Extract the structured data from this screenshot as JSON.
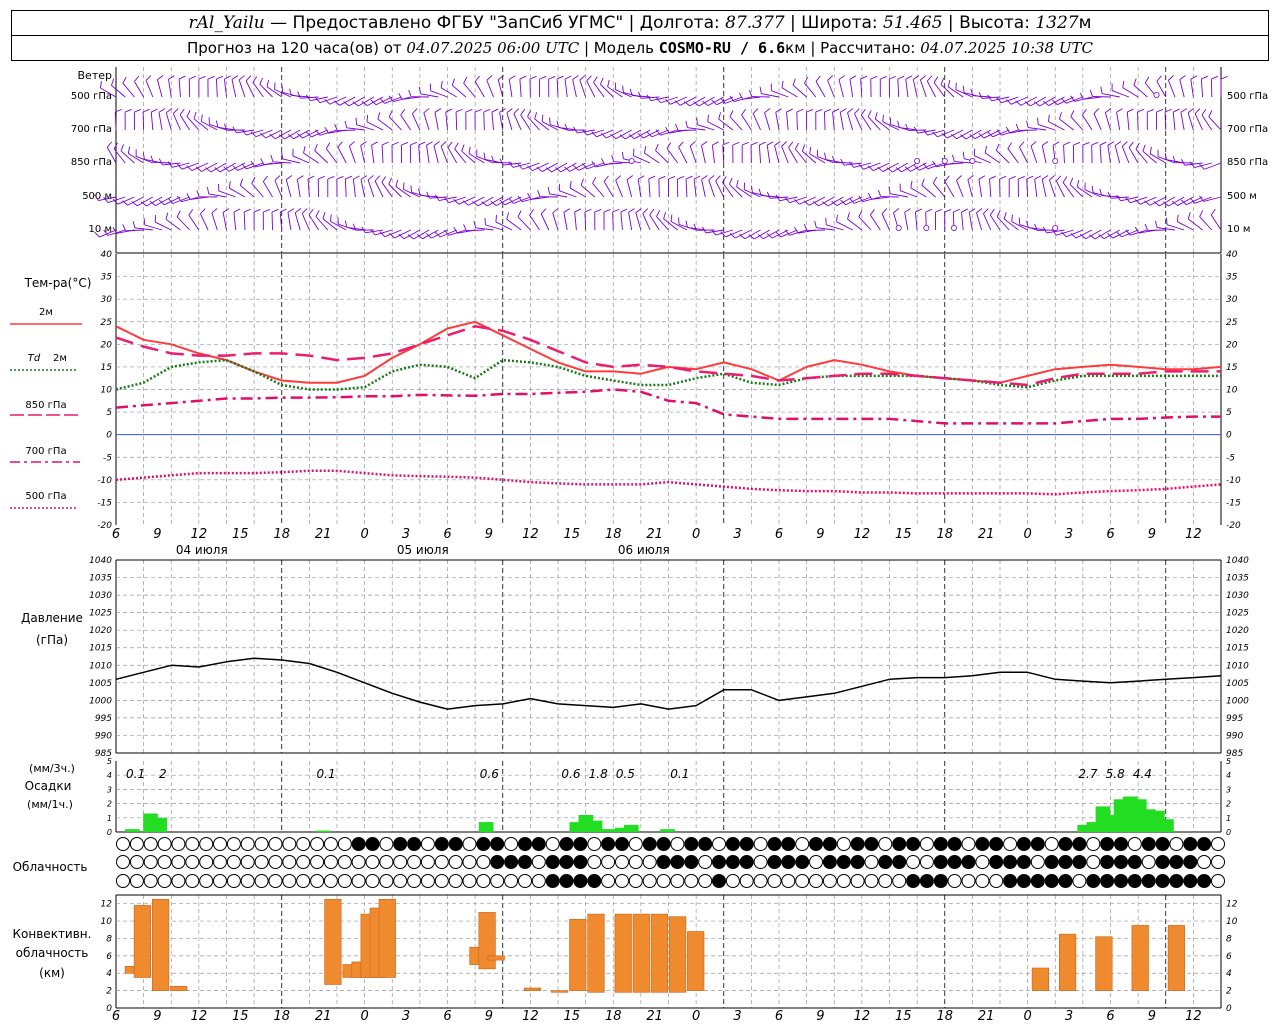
{
  "header": {
    "station": "rAl_Yailu",
    "dash": " — ",
    "provider": "Предоставлено ФГБУ \"ЗапСиб УГМС\"",
    "sep": " | ",
    "lon_label": "Долгота: ",
    "lon_value": "87.377",
    "lat_label": "Широта: ",
    "lat_value": "51.465",
    "alt_label": "Высота: ",
    "alt_value": "1327",
    "alt_unit": "м",
    "forecast_prefix": "Прогноз на 120 часа(ов) от ",
    "forecast_start": "04.07.2025 06:00 UTC",
    "model_label": "Модель ",
    "model_name": "COSMO-RU / 6.6",
    "model_unit": "км",
    "computed_label": "Рассчитано: ",
    "computed_value": "04.07.2025 10:38 UTC"
  },
  "colors": {
    "t2m": "#ff3b3b",
    "td2m": "#1a7a1a",
    "t850": "#ee1c6e",
    "t700": "#e0106a",
    "t500": "#e0106a",
    "wind": "#7a00d6",
    "zero_line": "#3355ff",
    "precip": "#22dd22",
    "convective": "#ef8a2f",
    "pressure": "#000000",
    "grid": "#999999"
  },
  "labels": {
    "wind_title": "Ветер",
    "wind_levels": [
      "500 гПа",
      "700 гПа",
      "850 гПа",
      "500 м",
      "10 м"
    ],
    "temp_title": "Тем-ра(°С)",
    "t2m_label": "2м",
    "td_label": "Td",
    "td_level": "2м",
    "t850_label": "850 гПа",
    "t700_label": "700 гПа",
    "t500_label": "500 гПа",
    "pressure_title": "Давление",
    "pressure_unit": "(гПа)",
    "precip_unit3": "(мм/3ч.)",
    "precip_title": "Осадки",
    "precip_unit1": "(мм/1ч.)",
    "cloud_title": "Облачность",
    "conv_title1": "Конвективн.",
    "conv_title2": "облачность",
    "conv_unit": "(км)"
  },
  "chart_data": [
    {
      "panel": "wind",
      "type": "wind_barbs",
      "levels": [
        "500 гПа",
        "700 гПа",
        "850 гПа",
        "500 м",
        "10 м"
      ],
      "x_hours": [
        0,
        120
      ]
    },
    {
      "panel": "temperature",
      "type": "line",
      "ylim": [
        -20,
        40
      ],
      "yticks": [
        -20,
        -15,
        -10,
        -5,
        0,
        5,
        10,
        15,
        20,
        25,
        30,
        35,
        40
      ],
      "x_tick_labels": [
        "6",
        "9",
        "12",
        "15",
        "18",
        "21",
        "0",
        "3",
        "6",
        "9",
        "12",
        "15",
        "18",
        "21",
        "0",
        "3",
        "6",
        "9",
        "12",
        "15",
        "18",
        "21",
        "0",
        "3",
        "6",
        "9",
        "12"
      ],
      "day_labels": [
        "04 июля",
        "05 июля",
        "06 июля"
      ],
      "x_hours": [
        0,
        3,
        6,
        9,
        12,
        15,
        18,
        21,
        24,
        27,
        30,
        33,
        36,
        39,
        42,
        45,
        48,
        51,
        54,
        57,
        60,
        63,
        66,
        69,
        72,
        75,
        78,
        81,
        84,
        87,
        90,
        93,
        96,
        99,
        102,
        105,
        108,
        111,
        114,
        117,
        120
      ],
      "series": [
        {
          "name": "2м",
          "style": "solid",
          "values": [
            24,
            21,
            20,
            18,
            16.5,
            14,
            12,
            11.5,
            11.5,
            13,
            17,
            20,
            23.5,
            25,
            22,
            19,
            16,
            14,
            14,
            13.5,
            15,
            14.5,
            16,
            14.5,
            12,
            15,
            16.5,
            15.5,
            14,
            13,
            12.5,
            12,
            11.5,
            13,
            14.5,
            15,
            15.5,
            15,
            14.5,
            14.5,
            15
          ]
        },
        {
          "name": "Td 2м",
          "style": "dotted",
          "values": [
            10,
            11.5,
            15,
            16,
            16.5,
            14,
            11,
            10,
            10,
            10.5,
            14,
            15.5,
            15,
            12.5,
            16.5,
            16,
            15,
            13,
            12,
            11,
            11,
            12.5,
            13.5,
            11.5,
            11,
            12.5,
            13,
            13,
            13,
            13,
            12.5,
            12,
            11,
            10.5,
            12,
            13,
            13,
            13,
            13,
            13,
            13
          ]
        },
        {
          "name": "850 гПа",
          "style": "long-dash",
          "values": [
            21.5,
            19.5,
            18,
            17.5,
            17.5,
            18,
            18,
            17.5,
            16.5,
            17,
            18,
            20,
            22,
            24,
            23,
            21,
            18.5,
            16,
            15,
            15.5,
            15,
            14,
            13.5,
            13,
            12,
            12.5,
            13,
            13.5,
            13.5,
            13,
            12.5,
            12,
            11.5,
            11,
            12.5,
            13.5,
            13.5,
            13.5,
            14,
            14,
            14
          ]
        },
        {
          "name": "700 гПа",
          "style": "dash-dot",
          "values": [
            6,
            6.5,
            7,
            7.5,
            8,
            8,
            8.2,
            8.2,
            8.3,
            8.5,
            8.5,
            8.8,
            8.7,
            8.6,
            9,
            9,
            9.3,
            9.5,
            10,
            9.5,
            7.5,
            7,
            4.5,
            4,
            3.5,
            3.5,
            3.5,
            3.5,
            3.5,
            3,
            2.5,
            2.5,
            2.5,
            2.5,
            2.5,
            3,
            3.5,
            3.5,
            3.8,
            4,
            4
          ]
        },
        {
          "name": "500 гПа",
          "style": "dotted",
          "values": [
            -10,
            -9.5,
            -9,
            -8.5,
            -8.5,
            -8.5,
            -8.3,
            -8,
            -8,
            -8.5,
            -9,
            -9.2,
            -9.3,
            -9.5,
            -10,
            -10.5,
            -10.8,
            -11,
            -11,
            -11,
            -10.5,
            -11,
            -11.5,
            -12,
            -12.3,
            -12.5,
            -12.5,
            -12.8,
            -12.8,
            -13,
            -13,
            -13,
            -13,
            -13,
            -13.2,
            -12.8,
            -12.5,
            -12.3,
            -12,
            -11.5,
            -11
          ]
        }
      ]
    },
    {
      "panel": "pressure",
      "type": "line",
      "ylim": [
        985,
        1040
      ],
      "yticks": [
        985,
        990,
        995,
        1000,
        1005,
        1010,
        1015,
        1020,
        1025,
        1030,
        1035,
        1040
      ],
      "x_hours": [
        0,
        3,
        6,
        9,
        12,
        15,
        18,
        21,
        24,
        27,
        30,
        33,
        36,
        39,
        42,
        45,
        48,
        51,
        54,
        57,
        60,
        63,
        66,
        69,
        72,
        75,
        78,
        81,
        84,
        87,
        90,
        93,
        96,
        99,
        102,
        105,
        108,
        111,
        114,
        117,
        120
      ],
      "series": [
        {
          "name": "Давление",
          "values": [
            1006,
            1008,
            1010,
            1009.5,
            1011,
            1012,
            1011.5,
            1010.5,
            1008,
            1005,
            1002,
            999.5,
            997.5,
            998.5,
            999,
            1000.5,
            999,
            998.5,
            998,
            999,
            997.5,
            998.5,
            1003,
            1003,
            1000,
            1001,
            1002,
            1004,
            1006,
            1006.5,
            1006.5,
            1007,
            1008,
            1008,
            1006,
            1005.5,
            1005,
            1005.5,
            1006,
            1006.5,
            1007
          ]
        }
      ]
    },
    {
      "panel": "precipitation",
      "type": "bar",
      "ylim": [
        0,
        5
      ],
      "yticks": [
        0,
        1,
        2,
        3,
        4,
        5
      ],
      "hourly_bars": [
        {
          "hour": 1,
          "value": 0.2
        },
        {
          "hour": 3,
          "value": 1.3
        },
        {
          "hour": 4,
          "value": 1.0
        },
        {
          "hour": 22,
          "value": 0.1
        },
        {
          "hour": 40,
          "value": 0.7
        },
        {
          "hour": 50,
          "value": 0.7
        },
        {
          "hour": 51,
          "value": 1.2
        },
        {
          "hour": 52,
          "value": 0.8
        },
        {
          "hour": 53,
          "value": 0.2
        },
        {
          "hour": 54,
          "value": 0.2
        },
        {
          "hour": 55,
          "value": 0.3
        },
        {
          "hour": 56,
          "value": 0.5
        },
        {
          "hour": 60,
          "value": 0.2
        },
        {
          "hour": 106,
          "value": 0.5
        },
        {
          "hour": 107,
          "value": 0.7
        },
        {
          "hour": 108,
          "value": 1.8
        },
        {
          "hour": 109,
          "value": 1.2
        },
        {
          "hour": 110,
          "value": 2.3
        },
        {
          "hour": 111,
          "value": 2.5
        },
        {
          "hour": 112,
          "value": 2.3
        },
        {
          "hour": 113,
          "value": 1.6
        },
        {
          "hour": 114,
          "value": 1.5
        },
        {
          "hour": 115,
          "value": 0.9
        }
      ],
      "three_hour_totals": [
        {
          "hour": 1.5,
          "label": "0.1"
        },
        {
          "hour": 4.5,
          "label": "2"
        },
        {
          "hour": 22.5,
          "label": "0.1"
        },
        {
          "hour": 40.5,
          "label": "0.6"
        },
        {
          "hour": 49.5,
          "label": "0.6"
        },
        {
          "hour": 52.5,
          "label": "1.8"
        },
        {
          "hour": 55.5,
          "label": "0.5"
        },
        {
          "hour": 61.5,
          "label": "0.1"
        },
        {
          "hour": 106.5,
          "label": "2.7"
        },
        {
          "hour": 109.5,
          "label": "5.8"
        },
        {
          "hour": 112.5,
          "label": "4.4"
        }
      ]
    },
    {
      "panel": "cloudiness",
      "type": "symbols",
      "rows": [
        "upper",
        "middle",
        "lower"
      ],
      "upper_filled_from_hour": 24,
      "middle_filled_ranges": [
        [
          38,
          46
        ],
        [
          46,
          53
        ],
        [
          59,
          86
        ],
        [
          89,
          120
        ]
      ],
      "lower_filled_ranges": [
        [
          46,
          52
        ],
        [
          64,
          66
        ],
        [
          86,
          90
        ],
        [
          96,
          104
        ],
        [
          105,
          120
        ]
      ]
    },
    {
      "panel": "convective",
      "type": "range_bar",
      "ylim": [
        0,
        13
      ],
      "yticks": [
        0,
        2,
        4,
        6,
        8,
        10,
        12
      ],
      "bars": [
        {
          "hour": 1,
          "bottom": 4,
          "top": 4.8
        },
        {
          "hour": 2,
          "bottom": 3.5,
          "top": 11.8
        },
        {
          "hour": 4,
          "bottom": 2,
          "top": 12.5
        },
        {
          "hour": 6,
          "bottom": 2,
          "top": 2.5
        },
        {
          "hour": 23,
          "bottom": 2.7,
          "top": 12.5
        },
        {
          "hour": 25,
          "bottom": 3.5,
          "top": 5
        },
        {
          "hour": 26,
          "bottom": 3.5,
          "top": 5.3
        },
        {
          "hour": 27,
          "bottom": 3.5,
          "top": 10.8
        },
        {
          "hour": 28,
          "bottom": 3.5,
          "top": 11.5
        },
        {
          "hour": 29,
          "bottom": 3.5,
          "top": 12.5
        },
        {
          "hour": 39,
          "bottom": 5,
          "top": 7
        },
        {
          "hour": 40,
          "bottom": 4.5,
          "top": 11
        },
        {
          "hour": 41,
          "bottom": 5.5,
          "top": 6
        },
        {
          "hour": 45,
          "bottom": 2,
          "top": 2.3
        },
        {
          "hour": 48,
          "bottom": 1.8,
          "top": 2
        },
        {
          "hour": 50,
          "bottom": 2,
          "top": 10.2
        },
        {
          "hour": 52,
          "bottom": 1.8,
          "top": 10.8
        },
        {
          "hour": 55,
          "bottom": 1.8,
          "top": 10.8
        },
        {
          "hour": 57,
          "bottom": 1.8,
          "top": 10.8
        },
        {
          "hour": 59,
          "bottom": 1.8,
          "top": 10.8
        },
        {
          "hour": 61,
          "bottom": 1.8,
          "top": 10.5
        },
        {
          "hour": 63,
          "bottom": 2,
          "top": 8.8
        },
        {
          "hour": 101,
          "bottom": 2,
          "top": 4.6
        },
        {
          "hour": 104,
          "bottom": 2,
          "top": 8.5
        },
        {
          "hour": 108,
          "bottom": 2,
          "top": 8.2
        },
        {
          "hour": 112,
          "bottom": 2,
          "top": 9.5
        },
        {
          "hour": 116,
          "bottom": 2,
          "top": 9.5
        }
      ]
    }
  ]
}
